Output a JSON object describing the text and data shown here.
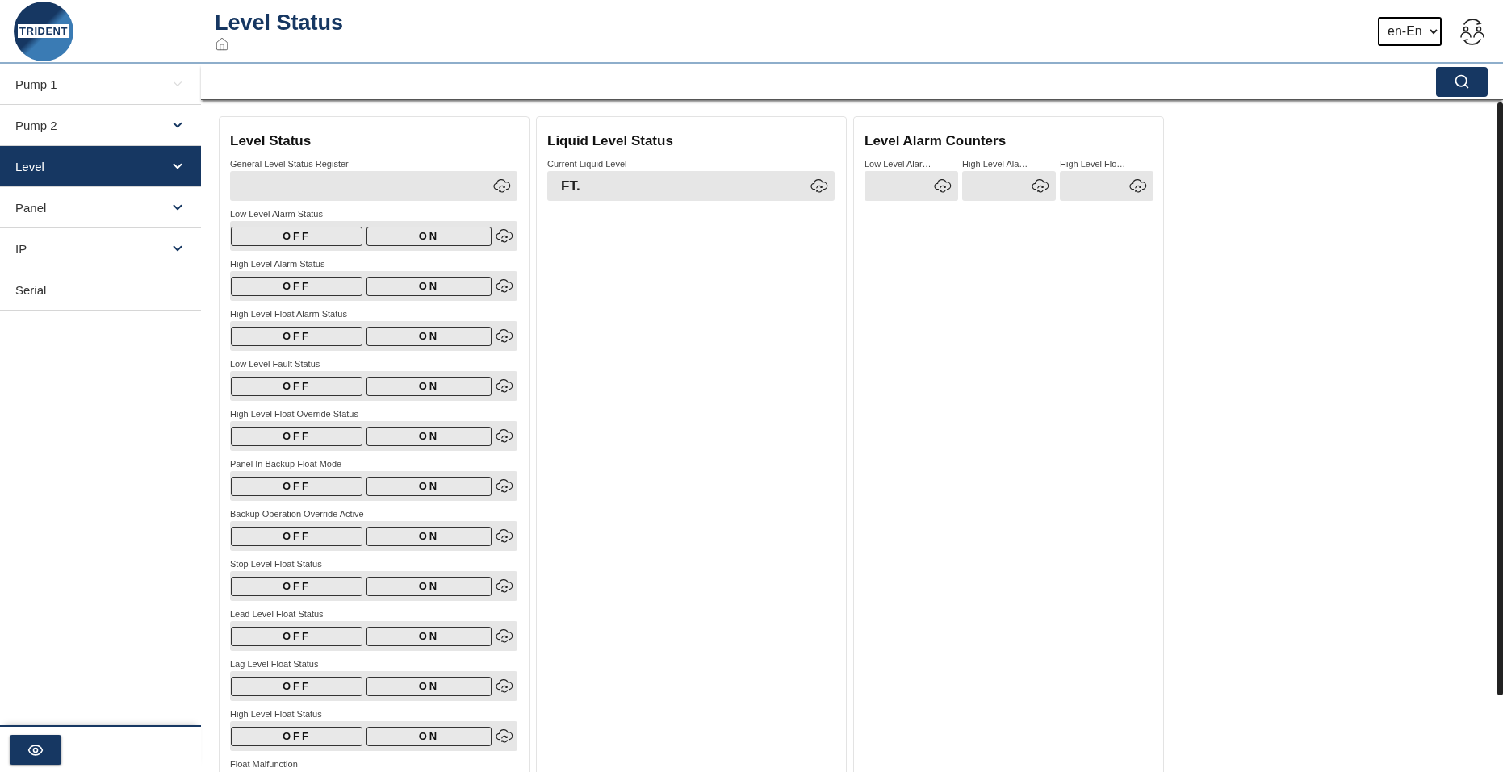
{
  "logo": {
    "text": "TRIDENT"
  },
  "header": {
    "title": "Level Status",
    "language": "en-En"
  },
  "sidebar": {
    "items": [
      {
        "label": "Pump 1",
        "selected": false,
        "kind": "faint"
      },
      {
        "label": "Pump 2",
        "selected": false,
        "kind": "dropdown"
      },
      {
        "label": "Level",
        "selected": true,
        "kind": "dropdown"
      },
      {
        "label": "Panel",
        "selected": false,
        "kind": "dropdown"
      },
      {
        "label": "IP",
        "selected": false,
        "kind": "dropdown"
      },
      {
        "label": "Serial",
        "selected": false,
        "kind": "link"
      }
    ]
  },
  "cards": [
    {
      "title": "Level Status",
      "kind": "stack",
      "fields": [
        {
          "kind": "value",
          "label": "General Level Status Register"
        },
        {
          "kind": "toggle",
          "label": "Low Level Alarm Status",
          "options": [
            "OFF",
            "ON"
          ]
        },
        {
          "kind": "toggle",
          "label": "High Level Alarm Status",
          "options": [
            "OFF",
            "ON"
          ]
        },
        {
          "kind": "toggle",
          "label": "High Level Float Alarm Status",
          "options": [
            "OFF",
            "ON"
          ]
        },
        {
          "kind": "toggle",
          "label": "Low Level Fault Status",
          "options": [
            "OFF",
            "ON"
          ]
        },
        {
          "kind": "toggle",
          "label": "High Level Float Override Status",
          "options": [
            "OFF",
            "ON"
          ]
        },
        {
          "kind": "toggle",
          "label": "Panel In Backup Float Mode",
          "options": [
            "OFF",
            "ON"
          ]
        },
        {
          "kind": "toggle",
          "label": "Backup Operation Override Active",
          "options": [
            "OFF",
            "ON"
          ]
        },
        {
          "kind": "toggle",
          "label": "Stop Level Float Status",
          "options": [
            "OFF",
            "ON"
          ]
        },
        {
          "kind": "toggle",
          "label": "Lead Level Float Status",
          "options": [
            "OFF",
            "ON"
          ]
        },
        {
          "kind": "toggle",
          "label": "Lag Level Float Status",
          "options": [
            "OFF",
            "ON"
          ]
        },
        {
          "kind": "toggle",
          "label": "High Level Float Status",
          "options": [
            "OFF",
            "ON"
          ]
        },
        {
          "kind": "cut",
          "label": "Float Malfunction"
        }
      ]
    },
    {
      "title": "Liquid Level Status",
      "kind": "stack",
      "fields": [
        {
          "kind": "value",
          "label": "Current Liquid Level",
          "unit": "FT."
        }
      ]
    },
    {
      "title": "Level Alarm Counters",
      "kind": "columns",
      "fields": [
        {
          "kind": "value",
          "label": "Low Level Alar…"
        },
        {
          "kind": "value",
          "label": "High Level Ala…"
        },
        {
          "kind": "value",
          "label": "High Level Flo…"
        }
      ]
    }
  ]
}
